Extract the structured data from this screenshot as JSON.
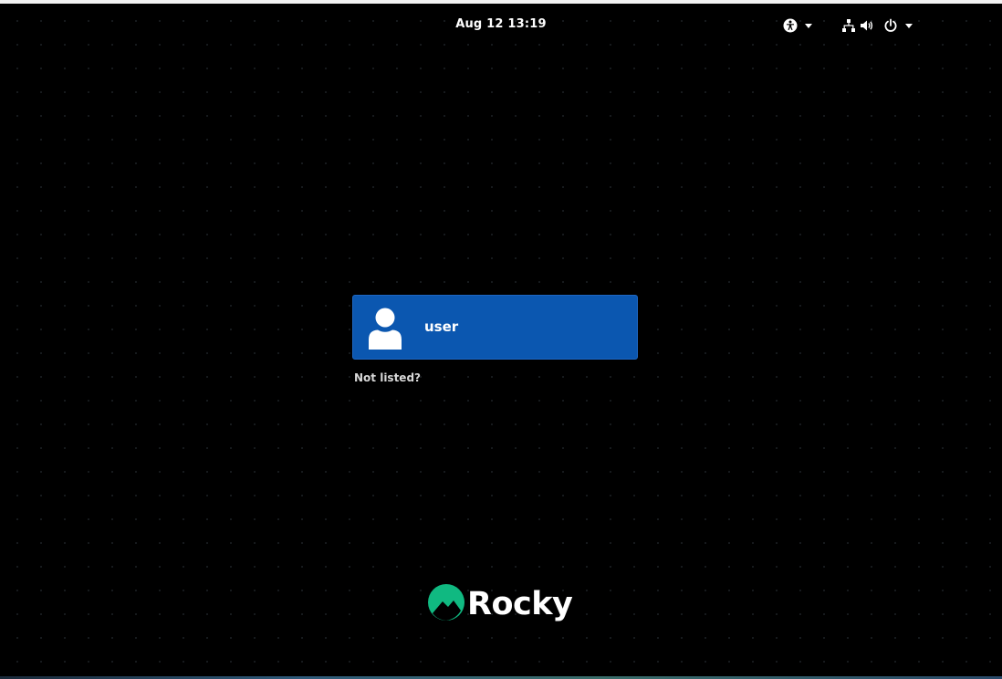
{
  "top_bar": {
    "clock": "Aug 12  13:19",
    "icons": {
      "accessibility": "accessibility-icon",
      "network": "network-wired-icon",
      "volume": "volume-icon",
      "power": "power-icon"
    }
  },
  "login": {
    "users": [
      {
        "name": "user",
        "avatar_icon": "user-avatar-icon"
      }
    ],
    "not_listed_label": "Not listed?"
  },
  "branding": {
    "logo_text": "Rocky",
    "logo_icon": "rocky-logo-icon",
    "accent_color": "#10b981"
  },
  "colors": {
    "background": "#000000",
    "selected_user": "#0b57b0"
  }
}
